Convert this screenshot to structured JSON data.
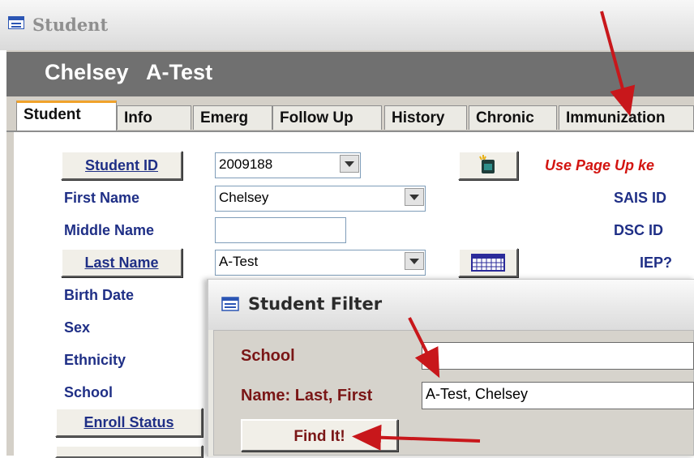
{
  "window": {
    "title": "Student"
  },
  "student_header": {
    "name": "Chelsey   A-Test"
  },
  "tabs": [
    "Student",
    "Info",
    "Emerg",
    "Follow Up",
    "History",
    "Chronic",
    "Immunization"
  ],
  "form": {
    "student_id_button": "Student ID",
    "student_id_value": "2009188",
    "first_name_label": "First Name",
    "first_name_value": "Chelsey",
    "middle_name_label": "Middle Name",
    "middle_name_value": "",
    "last_name_button": "Last Name",
    "last_name_value": "A-Test",
    "birth_date_label": "Birth Date",
    "sex_label": "Sex",
    "ethnicity_label": "Ethnicity",
    "school_label": "School",
    "enroll_status_button": "Enroll Status",
    "notice": "Use Page Up ke",
    "sais_id_label": "SAIS ID",
    "dsc_id_label": "DSC ID",
    "iep_label": "IEP?"
  },
  "dialog": {
    "title": "Student Filter",
    "school_label": "School",
    "school_value": "",
    "name_label": "Name: Last, First",
    "name_value": "A-Test, Chelsey",
    "find_button": "Find It!"
  },
  "colors": {
    "label_blue": "#1f2f86",
    "dialog_label": "#7a1616",
    "notice_red": "#d31410",
    "arrow_red": "#c8171b",
    "active_tab_accent": "#f0a22b",
    "header_gray": "#707070"
  },
  "icons": [
    "form-window-icon",
    "new-record-icon",
    "calendar-icon",
    "combo-dropdown-icon"
  ]
}
